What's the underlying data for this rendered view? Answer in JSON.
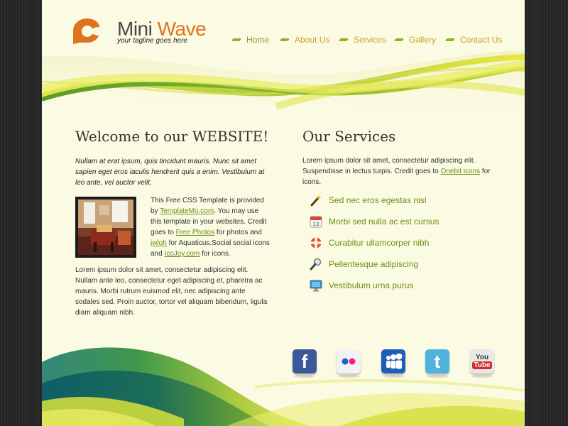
{
  "logo": {
    "title_part1": "Mini",
    "title_part2": "Wave",
    "tagline": "your tagline goes here",
    "icon": "logo-mark"
  },
  "nav": [
    {
      "label": "Home",
      "active": true
    },
    {
      "label": "About Us",
      "active": false
    },
    {
      "label": "Services",
      "active": false
    },
    {
      "label": "Gallery",
      "active": false
    },
    {
      "label": "Contact Us",
      "active": false
    }
  ],
  "welcome": {
    "title": "Welcome to our WEBSITE!",
    "intro": "Nullam at erat ipsum, quis tincidunt mauris. Nunc sit amet sapien eget eros iaculis hendrerit quis a enim. Vestibulum at leo ante, vel auctor velit.",
    "credit": {
      "t1": "This Free CSS Template is provided by ",
      "link1": "TemplateMo.com",
      "t2": ". You may use this template in your websites. Credit goes to ",
      "link2": "Free Photos",
      "t3": " for photos and ",
      "link3": "jwloh",
      "t4": " for Aquaticus.Social social icons and ",
      "link4": "IcoJoy.com",
      "t5": " for icons."
    },
    "body": "Lorem ipsum dolor sit amet, consectetur adipiscing elit. Nullam ante leo, consectetur eget adipiscing et, pharetra ac mauris. Morbi rutrum euismod elit, nec adipiscing ante sodales sed. Proin auctor, tortor vel aliquam bibendum, ligula diam aliquam nibh."
  },
  "services": {
    "title": "Our Services",
    "intro_t1": "Lorem ipsum dolor sit amet, consectetur adipiscing elit. Suspendisse in lectus turpis. Credit goes to ",
    "intro_link": "Onebit icons",
    "intro_t2": " for icons.",
    "items": [
      {
        "label": "Sed nec eros egestas nisl",
        "icon": "magic-wand-icon"
      },
      {
        "label": "Morbi sed nulla ac est cursus",
        "icon": "calendar-icon",
        "icon_text": "13"
      },
      {
        "label": "Curabitur ullamcorper nibh",
        "icon": "lifebuoy-icon"
      },
      {
        "label": "Pellentesque adipiscing",
        "icon": "magnifier-icon"
      },
      {
        "label": "Vestibulum urna purus",
        "icon": "monitor-icon"
      }
    ]
  },
  "social": [
    {
      "name": "facebook",
      "icon": "facebook-icon",
      "glyph": "f",
      "color": "#3b5998"
    },
    {
      "name": "flickr",
      "icon": "flickr-icon",
      "color": "#f2f2f2"
    },
    {
      "name": "myspace",
      "icon": "myspace-icon",
      "color": "#1d5fb8"
    },
    {
      "name": "twitter",
      "icon": "twitter-icon",
      "glyph": "t",
      "color": "#4fb3dd"
    },
    {
      "name": "youtube",
      "icon": "youtube-icon",
      "glyph_you": "You",
      "glyph_tube": "Tube",
      "color": "#e8e8e8"
    }
  ],
  "colors": {
    "accent_orange": "#e0741e",
    "accent_green": "#6c8e17",
    "nav_gold": "#c9a325",
    "page_bg": "#fbfbe3"
  }
}
